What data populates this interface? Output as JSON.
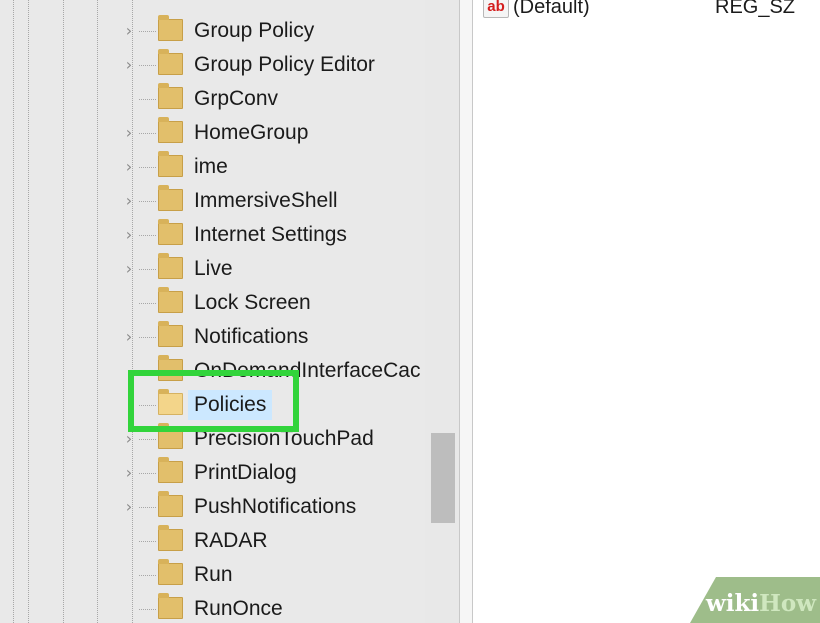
{
  "tree": {
    "items": [
      {
        "label": "Group Policy",
        "expandable": true,
        "selected": false
      },
      {
        "label": "Group Policy Editor",
        "expandable": true,
        "selected": false
      },
      {
        "label": "GrpConv",
        "expandable": false,
        "selected": false
      },
      {
        "label": "HomeGroup",
        "expandable": true,
        "selected": false
      },
      {
        "label": "ime",
        "expandable": true,
        "selected": false
      },
      {
        "label": "ImmersiveShell",
        "expandable": true,
        "selected": false
      },
      {
        "label": "Internet Settings",
        "expandable": true,
        "selected": false
      },
      {
        "label": "Live",
        "expandable": true,
        "selected": false
      },
      {
        "label": "Lock Screen",
        "expandable": false,
        "selected": false
      },
      {
        "label": "Notifications",
        "expandable": true,
        "selected": false
      },
      {
        "label": "OnDemandInterfaceCac",
        "expandable": false,
        "selected": false
      },
      {
        "label": "Policies",
        "expandable": false,
        "selected": true
      },
      {
        "label": "PrecisionTouchPad",
        "expandable": true,
        "selected": false
      },
      {
        "label": "PrintDialog",
        "expandable": true,
        "selected": false
      },
      {
        "label": "PushNotifications",
        "expandable": true,
        "selected": false
      },
      {
        "label": "RADAR",
        "expandable": false,
        "selected": false
      },
      {
        "label": "Run",
        "expandable": false,
        "selected": false
      },
      {
        "label": "RunOnce",
        "expandable": false,
        "selected": false
      }
    ]
  },
  "values": {
    "icon": "ab",
    "name": "(Default)",
    "type": "REG_SZ"
  },
  "watermark": {
    "part1": "wiki",
    "part2": "How"
  },
  "colors": {
    "highlight": "#32d43b",
    "selection": "#cce8ff",
    "folder": "#e2bf6b",
    "pane_bg": "#e9e9e9"
  }
}
